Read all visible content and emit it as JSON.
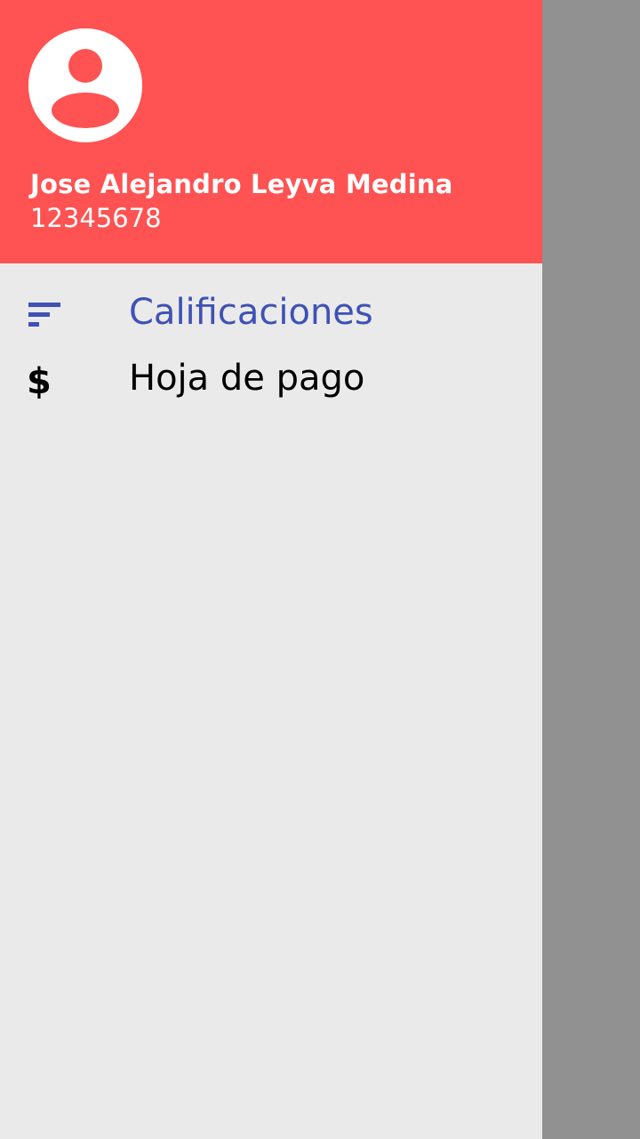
{
  "colors": {
    "header_bg": "#ff5252",
    "drawer_bg": "#eaeaea",
    "scrim": "#919191",
    "active": "#3f51b5"
  },
  "user": {
    "name": "Jose Alejandro Leyva Medina",
    "id": "12345678",
    "avatar_icon": "account-circle-icon"
  },
  "menu": {
    "items": [
      {
        "label": "Calificaciones",
        "icon": "sort-icon",
        "active": true
      },
      {
        "label": "Hoja de pago",
        "icon": "dollar-icon",
        "active": false
      }
    ]
  }
}
